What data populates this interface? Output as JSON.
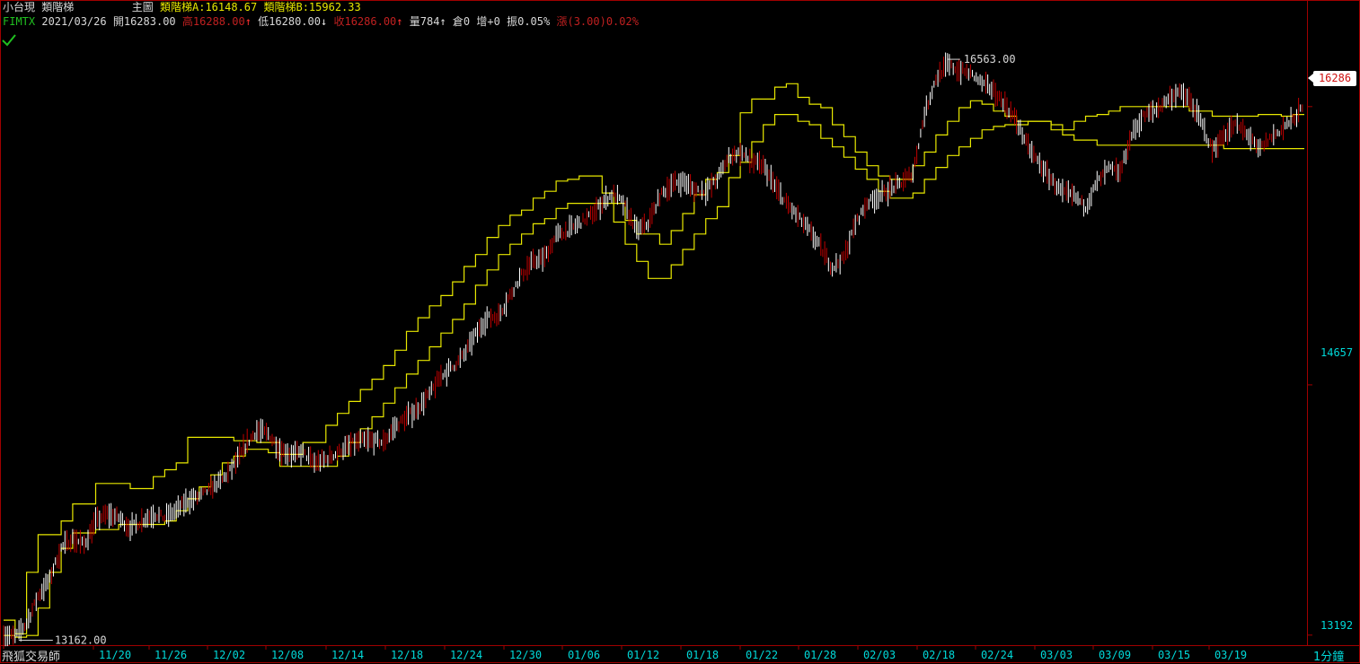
{
  "header": {
    "symbol_name": "小台現",
    "indicator": "類階梯",
    "main_label": "主圖",
    "ind_a_label": "類階梯A:",
    "ind_a_value": "16148.67",
    "ind_b_label": "類階梯B:",
    "ind_b_value": "15962.33"
  },
  "quote": {
    "code": "FIMTX",
    "date": "2021/03/26",
    "open_label": "開",
    "open": "16283.00",
    "high_label": "高",
    "high": "16288.00",
    "low_label": "低",
    "low": "16280.00",
    "close_label": "收",
    "close": "16286.00",
    "volume_label": "量",
    "volume": "784",
    "oi_label": "倉",
    "oi": "0",
    "inc_label": "增",
    "inc": "+0",
    "amp_label": "振",
    "amp": "0.05%",
    "chg_label": "漲",
    "chg": "(3.00)0.02%",
    "arrow_up": "↑",
    "arrow_down": "↓"
  },
  "footer": {
    "brand": "飛狐交易師",
    "period": "1分鐘"
  },
  "colors": {
    "background": "#000000",
    "frame": "#a00000",
    "candle": "#ffffff",
    "candle_down": "#c00000",
    "ladder": "#e8e800",
    "axis_text": "#00d8d8",
    "check": "#20c020"
  },
  "chart_data": {
    "type": "line",
    "xlabel": "",
    "ylabel": "",
    "x_ticks": [
      "11/20",
      "11/26",
      "12/02",
      "12/08",
      "12/14",
      "12/18",
      "12/24",
      "12/30",
      "01/06",
      "01/12",
      "01/18",
      "01/22",
      "01/28",
      "02/03",
      "02/18",
      "02/24",
      "03/03",
      "03/09",
      "03/15",
      "03/19"
    ],
    "y_ticks": [
      "16286",
      "14657",
      "13192"
    ],
    "last_price": "16286",
    "max_label": "16563.00",
    "min_label": "13162.00",
    "ylim": [
      13170,
      16700
    ],
    "series": [
      {
        "name": "",
        "type": "candles-approx",
        "values": [
          13200,
          13180,
          13260,
          13420,
          13520,
          13700,
          13760,
          13720,
          13860,
          13900,
          13880,
          13820,
          13860,
          13900,
          13880,
          13920,
          13980,
          14000,
          14050,
          14100,
          14180,
          14300,
          14390,
          14370,
          14280,
          14250,
          14260,
          14200,
          14220,
          14260,
          14300,
          14330,
          14330,
          14320,
          14410,
          14470,
          14520,
          14600,
          14710,
          14760,
          14830,
          14950,
          15050,
          15060,
          15180,
          15300,
          15380,
          15400,
          15530,
          15560,
          15600,
          15650,
          15720,
          15780,
          15700,
          15560,
          15600,
          15760,
          15830,
          15850,
          15800,
          15790,
          15860,
          15990,
          16020,
          15960,
          15940,
          15820,
          15720,
          15640,
          15560,
          15460,
          15340,
          15400,
          15600,
          15720,
          15760,
          15800,
          15840,
          15900,
          16240,
          16450,
          16530,
          16500,
          16480,
          16420,
          16380,
          16300,
          16200,
          16050,
          15950,
          15860,
          15780,
          15760,
          15700,
          15840,
          15920,
          15900,
          16120,
          16230,
          16260,
          16320,
          16370,
          16330,
          16200,
          16030,
          16120,
          16180,
          16130,
          16030,
          16100,
          16150,
          16210,
          16286
        ]
      },
      {
        "name": "",
        "type": "step",
        "values": [
          13280,
          13200,
          13560,
          13780,
          13780,
          13860,
          13960,
          13960,
          14080,
          14080,
          14080,
          14050,
          14050,
          14120,
          14160,
          14200,
          14350,
          14350,
          14350,
          14350,
          14330,
          14330,
          14320,
          14320,
          14250,
          14250,
          14320,
          14320,
          14420,
          14490,
          14560,
          14630,
          14690,
          14770,
          14860,
          14970,
          15050,
          15120,
          15180,
          15260,
          15350,
          15420,
          15520,
          15590,
          15650,
          15680,
          15750,
          15790,
          15850,
          15860,
          15880,
          15880,
          15780,
          15720,
          15620,
          15540,
          15540,
          15480,
          15560,
          15660,
          15770,
          15860,
          15900,
          16000,
          16250,
          16330,
          16330,
          16400,
          16420,
          16340,
          16300,
          16280,
          16180,
          16110,
          16020,
          15940,
          15880,
          15860,
          15860,
          15940,
          16020,
          16120,
          16200,
          16280,
          16320,
          16300,
          16260,
          16230,
          16200,
          16200,
          16200,
          16150,
          16150,
          16200,
          16230,
          16240,
          16260,
          16286,
          16286,
          16286,
          16286,
          16286,
          16286,
          16260,
          16260,
          16230,
          16230,
          16230,
          16230,
          16240,
          16240,
          16230,
          16240,
          16240
        ]
      },
      {
        "name": "",
        "type": "step",
        "values": [
          13190,
          13180,
          13190,
          13350,
          13560,
          13700,
          13790,
          13790,
          13810,
          13810,
          13840,
          13840,
          13840,
          13840,
          13860,
          13920,
          13990,
          14060,
          14130,
          14200,
          14240,
          14280,
          14280,
          14260,
          14180,
          14180,
          14180,
          14180,
          14180,
          14240,
          14320,
          14400,
          14470,
          14550,
          14640,
          14720,
          14800,
          14880,
          14960,
          15040,
          15130,
          15240,
          15330,
          15420,
          15480,
          15540,
          15600,
          15630,
          15690,
          15720,
          15720,
          15720,
          15720,
          15610,
          15480,
          15380,
          15280,
          15280,
          15360,
          15450,
          15540,
          15630,
          15700,
          15870,
          15960,
          16080,
          16180,
          16240,
          16240,
          16200,
          16180,
          16100,
          16050,
          15990,
          15920,
          15860,
          15790,
          15750,
          15750,
          15780,
          15860,
          15930,
          16000,
          16050,
          16100,
          16150,
          16170,
          16180,
          16180,
          16200,
          16200,
          16180,
          16120,
          16090,
          16090,
          16060,
          16060,
          16060,
          16060,
          16060,
          16060,
          16060,
          16060,
          16060,
          16060,
          16060,
          16040,
          16040,
          16040,
          16040,
          16040,
          16040,
          16040,
          16040
        ]
      }
    ]
  }
}
